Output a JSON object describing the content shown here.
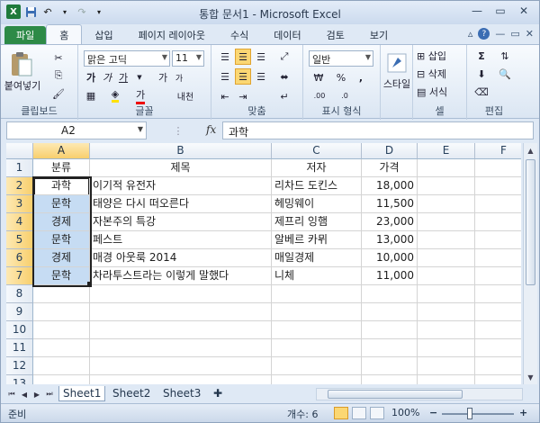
{
  "titlebar": {
    "title": "통합 문서1 - Microsoft Excel",
    "app_icon": "X",
    "buttons": {
      "minimize": "—",
      "maximize": "▭",
      "close": "✕"
    }
  },
  "ribbon_tabs": [
    {
      "label": "파일"
    },
    {
      "label": "홈"
    },
    {
      "label": "삽입"
    },
    {
      "label": "페이지 레이아웃"
    },
    {
      "label": "수식"
    },
    {
      "label": "데이터"
    },
    {
      "label": "검토"
    },
    {
      "label": "보기"
    }
  ],
  "ribbon": {
    "clipboard": {
      "paste": "붙여넣기",
      "label": "클립보드"
    },
    "font": {
      "name": "맑은 고딕",
      "size": "11",
      "bold": "가",
      "italic": "가",
      "underline": "가",
      "grow": "가",
      "shrink": "가",
      "fontcolor": "가",
      "phonetic": "내천",
      "label": "글꼴"
    },
    "alignment": {
      "label": "맞춤"
    },
    "number": {
      "format": "일반",
      "percent": "%",
      "comma": ",",
      "label": "표시 형식"
    },
    "styles": {
      "button": "스타일",
      "label": ""
    },
    "cells": {
      "insert": "삽입",
      "delete": "삭제",
      "format": "서식",
      "label": "셀"
    },
    "editing": {
      "sum": "Σ",
      "label": "편집"
    }
  },
  "formula_bar": {
    "name_box": "A2",
    "fx": "fx",
    "content": "과학"
  },
  "columns": [
    "A",
    "B",
    "C",
    "D",
    "E",
    "F"
  ],
  "rows": [
    "1",
    "2",
    "3",
    "4",
    "5",
    "6",
    "7",
    "8",
    "9",
    "10",
    "11",
    "12",
    "13"
  ],
  "table": {
    "header": [
      "분류",
      "제목",
      "저자",
      "가격"
    ],
    "data": [
      [
        "과학",
        "이기적 유전자",
        "리차드 도킨스",
        "18,000"
      ],
      [
        "문학",
        "태양은 다시 떠오른다",
        "헤밍웨이",
        "11,500"
      ],
      [
        "경제",
        "자본주의 특강",
        "제프리 잉햄",
        "23,000"
      ],
      [
        "문학",
        "페스트",
        "알베르 카뮈",
        "13,000"
      ],
      [
        "경제",
        "매경 아웃룩 2014",
        "매일경제",
        "10,000"
      ],
      [
        "문학",
        "차라투스트라는 이렇게 말했다",
        "니체",
        "11,000"
      ]
    ]
  },
  "sheets": [
    "Sheet1",
    "Sheet2",
    "Sheet3"
  ],
  "status": {
    "ready": "준비",
    "count": "개수: 6",
    "zoom": "100%",
    "minus": "−",
    "plus": "+"
  }
}
